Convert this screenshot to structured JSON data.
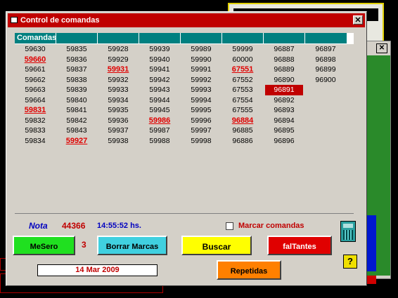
{
  "window": {
    "title": "Control de comandas",
    "close_glyph": "✕"
  },
  "bg_window": {
    "close_glyph": "✕"
  },
  "grid": {
    "header_label": "Comandas",
    "columns": [
      [
        "59630",
        "59660",
        "59661",
        "59662",
        "59663",
        "59664",
        "59831",
        "59832",
        "59833",
        "59834"
      ],
      [
        "59835",
        "59836",
        "59837",
        "59838",
        "59839",
        "59840",
        "59841",
        "59842",
        "59843",
        "59927"
      ],
      [
        "59928",
        "59929",
        "59931",
        "59932",
        "59933",
        "59934",
        "59935",
        "59936",
        "59937",
        "59938"
      ],
      [
        "59939",
        "59940",
        "59941",
        "59942",
        "59943",
        "59944",
        "59945",
        "59986",
        "59987",
        "59988"
      ],
      [
        "59989",
        "59990",
        "59991",
        "59992",
        "59993",
        "59994",
        "59995",
        "59996",
        "59997",
        "59998"
      ],
      [
        "59999",
        "60000",
        "67551",
        "67552",
        "67553",
        "67554",
        "67555",
        "96884",
        "96885",
        "96886"
      ],
      [
        "96887",
        "96888",
        "96889",
        "96890",
        "96891",
        "96892",
        "96893",
        "96894",
        "96895",
        "96896"
      ],
      [
        "96897",
        "96898",
        "96899",
        "96900"
      ]
    ],
    "marked": [
      "59660",
      "59831",
      "59927",
      "59931",
      "59986",
      "67551",
      "96884"
    ],
    "selected": "96891"
  },
  "nota": {
    "label": "Nota",
    "value": "44366",
    "time": "14:55:52 hs."
  },
  "marcar": {
    "label": "Marcar comandas",
    "checked": false
  },
  "buttons": {
    "mesero": "MeSero",
    "borrar": "Borrar Marcas",
    "buscar": "Buscar",
    "faltantes": "falTantes",
    "repetidas": "Repetidas",
    "help": "?"
  },
  "mesero_count": "3",
  "date": "14 Mar 2009",
  "icons": {
    "calculator": "calculator-icon",
    "help": "help-icon",
    "window": "window-icon"
  }
}
